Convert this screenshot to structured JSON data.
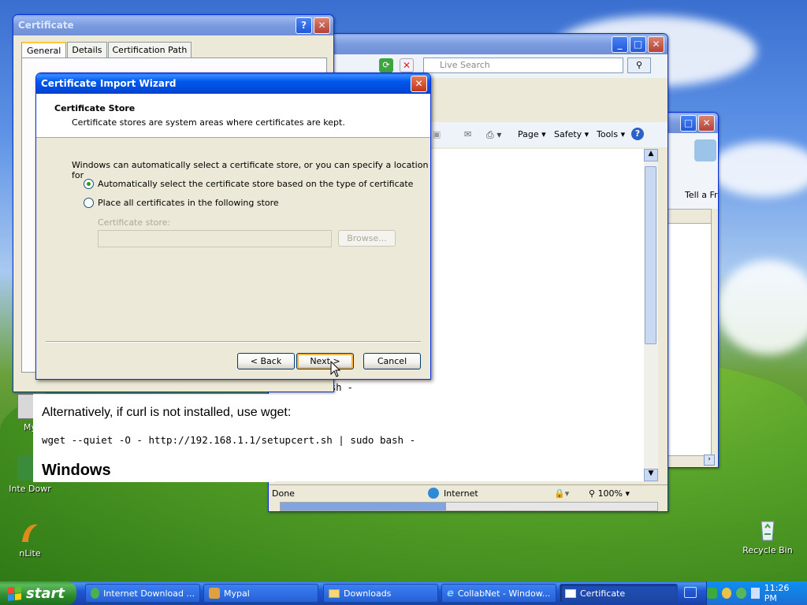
{
  "cert_window": {
    "title": "Certificate",
    "help_btn": "?",
    "close_btn": "✕",
    "tabs": [
      "General",
      "Details",
      "Certification Path"
    ]
  },
  "ie_window": {
    "search_placeholder": "Live Search",
    "toolbar": {
      "page": "Page ▾",
      "safety": "Safety ▾",
      "tools": "Tools ▾"
    },
    "text_partial": "sh -",
    "alt_text": "Alternatively, if curl is not installed, use wget:",
    "command": "wget --quiet -O - http://192.168.1.1/setupcert.sh | sudo bash -",
    "heading": "Windows",
    "status": {
      "left": "Done",
      "zone": "Internet",
      "zoom": "100%"
    }
  },
  "bg_window": {
    "label": "Tell a Frie"
  },
  "wizard": {
    "title": "Certificate Import Wizard",
    "header_title": "Certificate Store",
    "header_desc": "Certificate stores are system areas where certificates are kept.",
    "intro": "Windows can automatically select a certificate store, or you can specify a location for",
    "radio_auto": "Automatically select the certificate store based on the type of certificate",
    "radio_manual": "Place all certificates in the following store",
    "store_label": "Certificate store:",
    "browse": "Browse...",
    "back": "< Back",
    "next": "Next >",
    "cancel": "Cancel",
    "auto_selected": true
  },
  "desktop_icons": [
    {
      "label": "My"
    },
    {
      "label": "Inte Dowr"
    },
    {
      "label": "nLite"
    },
    {
      "label": "Recycle Bin"
    }
  ],
  "taskbar": {
    "start": "start",
    "items": [
      "Internet Download ...",
      "Mypal",
      "Downloads",
      "CollabNet - Window...",
      "Certificate"
    ],
    "clock": "11:26 PM"
  }
}
